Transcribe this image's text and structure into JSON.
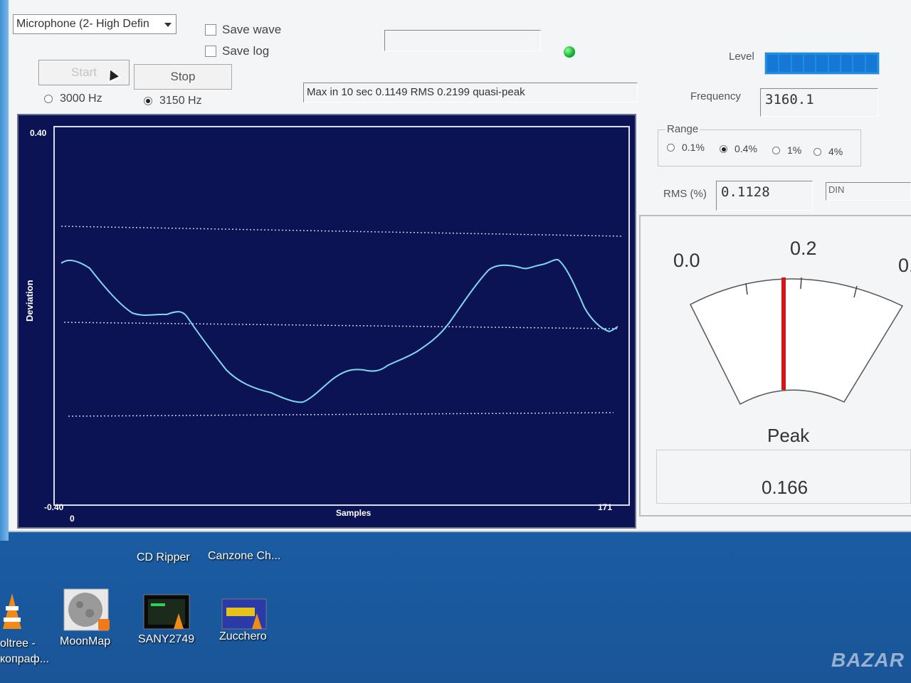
{
  "toolbar": {
    "device_select": "Microphone (2- High Defin",
    "save_wave": "Save wave",
    "save_log": "Save log",
    "start": "Start",
    "stop": "Stop",
    "freq_3000": "3000 Hz",
    "freq_3150": "3150 Hz",
    "selected_freq": "3150 Hz",
    "status_text": "Max in 10 sec 0.1149 RMS 0.2199 quasi-peak"
  },
  "readouts": {
    "level_label": "Level",
    "level_segments": 9,
    "frequency_label": "Frequency",
    "frequency_value": "3160.1",
    "range_label": "Range",
    "range_options": [
      "0.1%",
      "0.4%",
      "1%",
      "4%"
    ],
    "range_selected": "0.4%",
    "rms_label": "RMS (%)",
    "rms_value": "0.1128",
    "din_label": "DIN"
  },
  "graph": {
    "y_max_label": "0.40",
    "y_min_label": "-0.40",
    "y_axis_title": "Deviation",
    "x_min_label": "0",
    "x_max_label": "171",
    "x_axis_title": "Samples",
    "trace_color": "#7fd8f0",
    "background_color": "#0b1355"
  },
  "meter": {
    "scale_left": "0.0",
    "scale_mid": "0.2",
    "scale_right": "0.",
    "peak_label": "Peak",
    "peak_value": "0.166",
    "needle_color": "#d01818"
  },
  "desktop": {
    "icons": [
      {
        "label": "CD Ripper",
        "icon": "cd-ripper-icon"
      },
      {
        "label": "Canzone Ch...",
        "icon": "shortcut-icon"
      },
      {
        "label": "oltree -",
        "icon": "vlc-cone-icon"
      },
      {
        "label": "копраф...",
        "icon": "vlc-cone-icon"
      },
      {
        "label": "MoonMap",
        "icon": "moon-icon"
      },
      {
        "label": "SANY2749",
        "icon": "video-file-icon"
      },
      {
        "label": "Zucchero",
        "icon": "video-file-icon"
      }
    ],
    "watermark": "BAZAR"
  }
}
